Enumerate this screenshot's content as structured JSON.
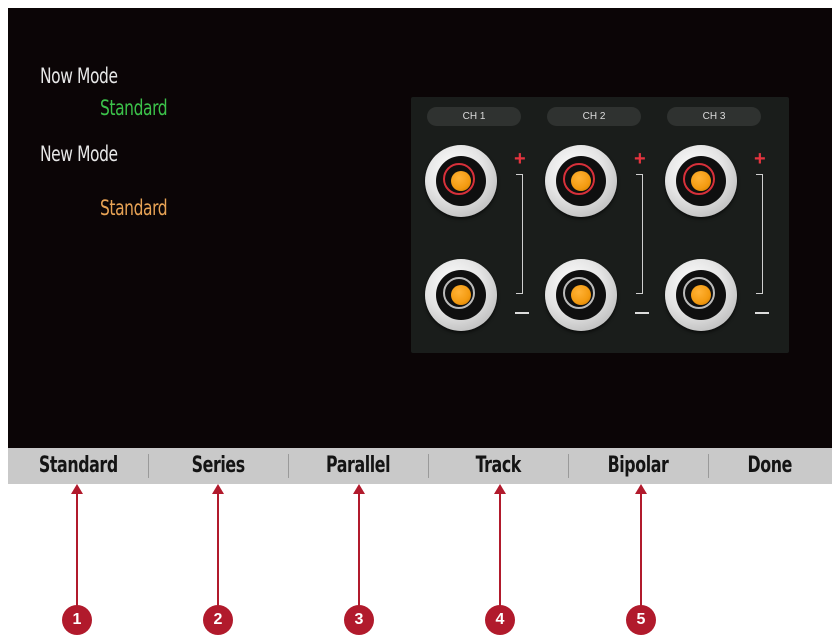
{
  "mode_info": {
    "now_label": "Now Mode",
    "now_value": "Standard",
    "new_label": "New Mode",
    "new_value": "Standard"
  },
  "channels": [
    {
      "label": "CH 1"
    },
    {
      "label": "CH 2"
    },
    {
      "label": "CH 3"
    }
  ],
  "terminal_marks": {
    "positive": "+",
    "negative": "−"
  },
  "softkeys": [
    {
      "label": "Standard"
    },
    {
      "label": "Series"
    },
    {
      "label": "Parallel"
    },
    {
      "label": "Track"
    },
    {
      "label": "Bipolar"
    },
    {
      "label": "Done"
    }
  ],
  "callouts": [
    "1",
    "2",
    "3",
    "4",
    "5"
  ],
  "colors": {
    "now_value": "#3cc24a",
    "new_value": "#e8a355",
    "callout": "#b11a2c",
    "positive_ring": "#d7303a",
    "terminal_core": "#f39a10"
  }
}
